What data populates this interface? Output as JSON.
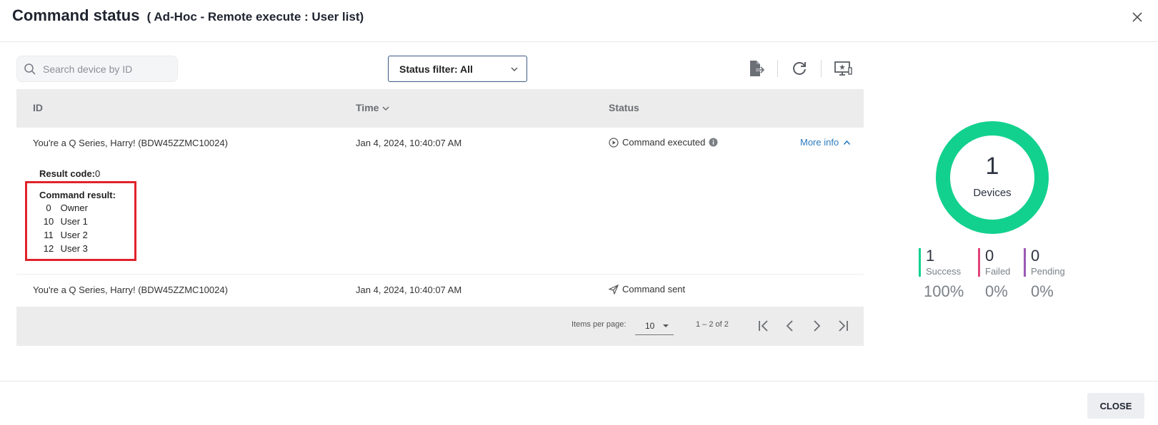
{
  "dialog": {
    "title": "Command status",
    "subtitle": "( Ad-Hoc - Remote execute : User list)"
  },
  "search": {
    "placeholder": "Search device by ID",
    "value": ""
  },
  "status_filter": {
    "label": "Status filter: All"
  },
  "toolbar": {
    "icons": [
      "export-icon",
      "refresh-icon",
      "remote-screen-icon"
    ]
  },
  "table": {
    "columns": {
      "id": "ID",
      "time": "Time",
      "status": "Status"
    },
    "rows": [
      {
        "id": "You're a Q Series, Harry! (BDW45ZZMC10024)",
        "time": "Jan 4, 2024, 10:40:07 AM",
        "status": "Command executed",
        "more_info": "More info"
      },
      {
        "id": "You're a Q Series, Harry! (BDW45ZZMC10024)",
        "time": "Jan 4, 2024, 10:40:07 AM",
        "status": "Command sent"
      }
    ],
    "details": {
      "result_code_label": "Result code:",
      "result_code_value": "0",
      "command_result_label": "Command result:",
      "items": [
        {
          "num": "0",
          "name": "Owner"
        },
        {
          "num": "10",
          "name": "User 1"
        },
        {
          "num": "11",
          "name": "User 2"
        },
        {
          "num": "12",
          "name": "User 3"
        }
      ]
    },
    "pager": {
      "items_per_page_label": "Items per page:",
      "items_per_page_value": "10",
      "range": "1 – 2 of 2"
    }
  },
  "summary": {
    "total": "1",
    "total_label": "Devices",
    "success_fraction": 1.0,
    "stats": [
      {
        "count": "1",
        "label": "Success",
        "pct": "100%",
        "color": "#12d18e"
      },
      {
        "count": "0",
        "label": "Failed",
        "pct": "0%",
        "color": "#e0447a"
      },
      {
        "count": "0",
        "label": "Pending",
        "pct": "0%",
        "color": "#9b59b6"
      }
    ]
  },
  "footer": {
    "close_label": "CLOSE"
  }
}
